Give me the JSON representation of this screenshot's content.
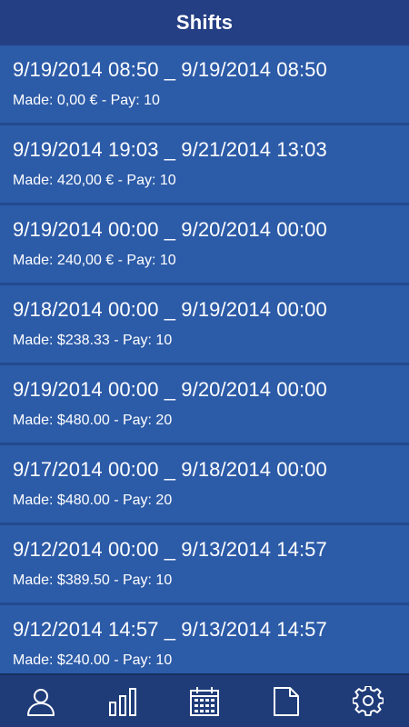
{
  "header": {
    "title": "Shifts"
  },
  "shifts": [
    {
      "period": "9/19/2014 08:50 _ 9/19/2014 08:50",
      "meta": "Made: 0,00 € - Pay: 10"
    },
    {
      "period": "9/19/2014 19:03 _ 9/21/2014 13:03",
      "meta": "Made: 420,00 € - Pay: 10"
    },
    {
      "period": "9/19/2014 00:00 _ 9/20/2014 00:00",
      "meta": "Made: 240,00 € - Pay: 10"
    },
    {
      "period": "9/18/2014 00:00 _ 9/19/2014 00:00",
      "meta": "Made: $238.33 - Pay: 10"
    },
    {
      "period": "9/19/2014 00:00 _ 9/20/2014 00:00",
      "meta": "Made: $480.00 - Pay: 20"
    },
    {
      "period": "9/17/2014 00:00 _ 9/18/2014 00:00",
      "meta": "Made: $480.00 - Pay: 20"
    },
    {
      "period": "9/12/2014 00:00 _ 9/13/2014 14:57",
      "meta": "Made: $389.50 - Pay: 10"
    },
    {
      "period": "9/12/2014 14:57 _ 9/13/2014 14:57",
      "meta": "Made: $240.00 - Pay: 10"
    }
  ],
  "tabbar": {
    "items": [
      {
        "icon": "user-icon"
      },
      {
        "icon": "bar-chart-icon"
      },
      {
        "icon": "calendar-icon"
      },
      {
        "icon": "document-icon"
      },
      {
        "icon": "gear-icon"
      }
    ]
  },
  "colors": {
    "header": "#253f85",
    "row": "#2c5ba8",
    "separator": "#234a8f",
    "tabbar": "#1f3c79",
    "text": "#ffffff"
  }
}
